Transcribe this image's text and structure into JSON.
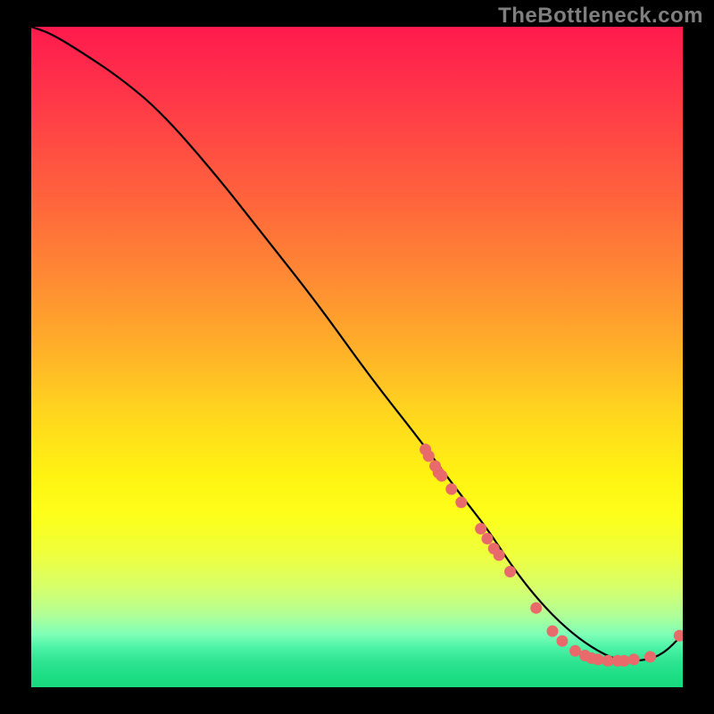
{
  "watermark": "TheBottleneck.com",
  "colors": {
    "background": "#000000",
    "watermark_text": "#7f7f7f",
    "curve": "#000000",
    "marker": "#e86a6a",
    "gradient_top": "#ff1a4d",
    "gradient_bottom": "#18d97e"
  },
  "chart_data": {
    "type": "line",
    "title": "",
    "xlabel": "",
    "ylabel": "",
    "xlim": [
      0,
      100
    ],
    "ylim": [
      0,
      100
    ],
    "series": [
      {
        "name": "curve",
        "x": [
          0,
          3,
          8,
          14,
          20,
          28,
          36,
          44,
          52,
          60,
          66,
          70,
          74,
          78,
          82,
          86,
          90,
          94,
          97,
          100
        ],
        "y": [
          100,
          99,
          96,
          92,
          87,
          78,
          68,
          58,
          47,
          37,
          29,
          24,
          18,
          13,
          9,
          6,
          4,
          4,
          5,
          8
        ]
      }
    ],
    "markers": [
      {
        "x": 60.5,
        "y": 36
      },
      {
        "x": 61,
        "y": 35
      },
      {
        "x": 62,
        "y": 33.5
      },
      {
        "x": 62.5,
        "y": 32.5
      },
      {
        "x": 63,
        "y": 32
      },
      {
        "x": 64.5,
        "y": 30
      },
      {
        "x": 66,
        "y": 28
      },
      {
        "x": 69,
        "y": 24
      },
      {
        "x": 70,
        "y": 22.5
      },
      {
        "x": 71,
        "y": 21
      },
      {
        "x": 71.8,
        "y": 20
      },
      {
        "x": 73.5,
        "y": 17.5
      },
      {
        "x": 77.5,
        "y": 12
      },
      {
        "x": 80,
        "y": 8.5
      },
      {
        "x": 81.5,
        "y": 7
      },
      {
        "x": 83.5,
        "y": 5.5
      },
      {
        "x": 85,
        "y": 4.8
      },
      {
        "x": 86,
        "y": 4.4
      },
      {
        "x": 87,
        "y": 4.2
      },
      {
        "x": 88.5,
        "y": 4
      },
      {
        "x": 90,
        "y": 4
      },
      {
        "x": 91,
        "y": 4
      },
      {
        "x": 92.5,
        "y": 4.2
      },
      {
        "x": 95,
        "y": 4.6
      },
      {
        "x": 99.5,
        "y": 7.8
      }
    ]
  }
}
